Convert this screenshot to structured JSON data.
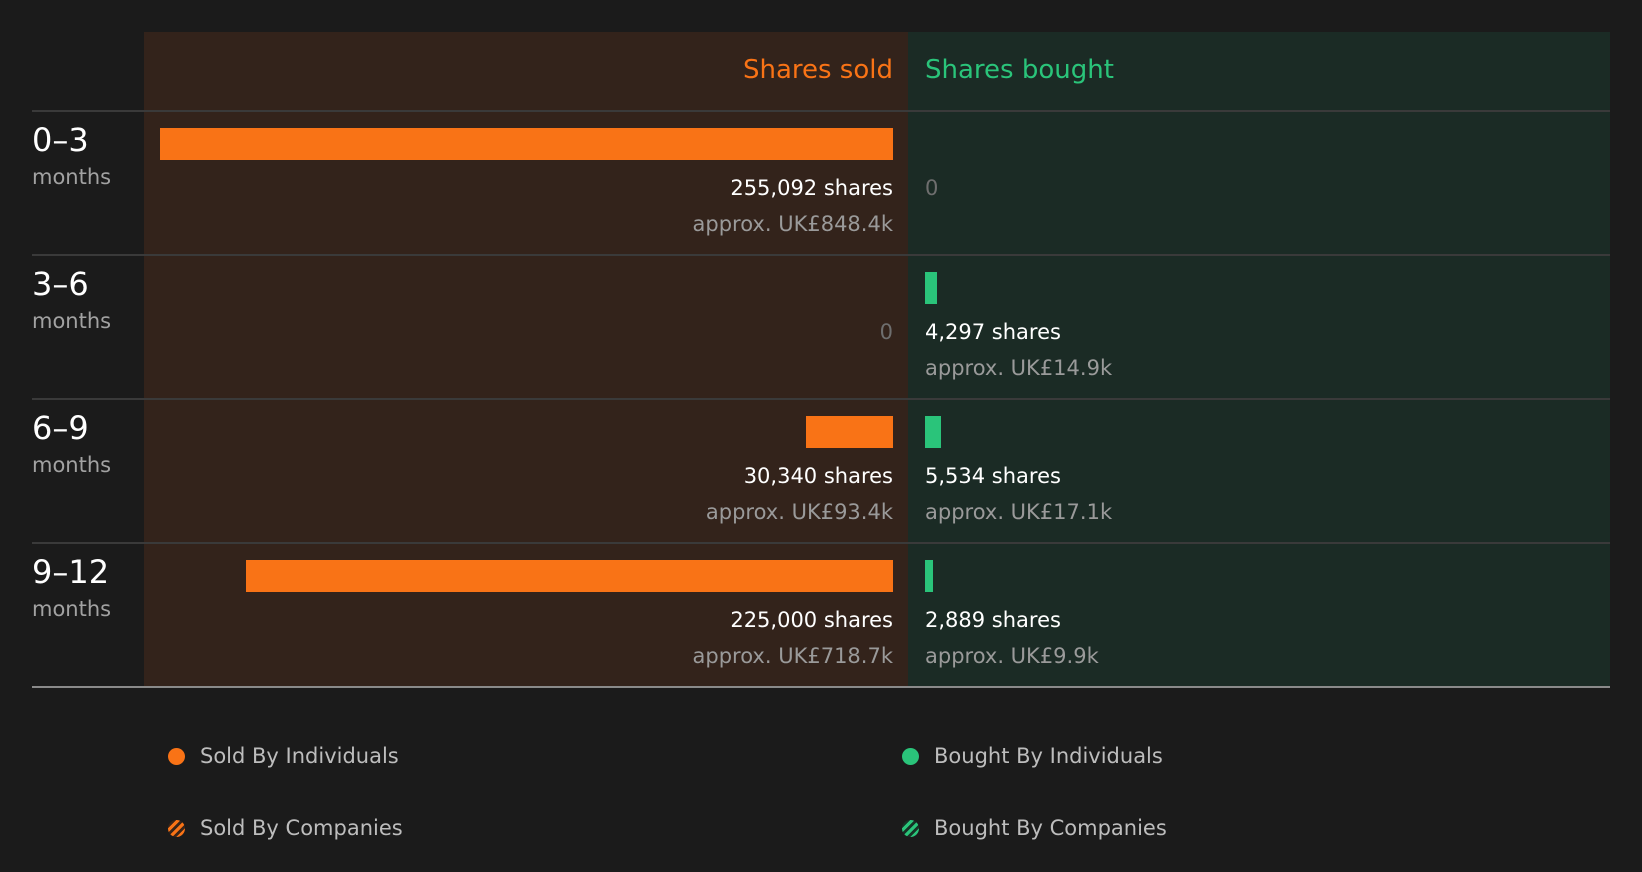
{
  "chart_data": {
    "type": "bar",
    "headers": {
      "sold": "Shares sold",
      "bought": "Shares bought"
    },
    "categories": [
      {
        "range": "0–3",
        "unit": "months"
      },
      {
        "range": "3–6",
        "unit": "months"
      },
      {
        "range": "6–9",
        "unit": "months"
      },
      {
        "range": "9–12",
        "unit": "months"
      }
    ],
    "series": [
      {
        "name": "Shares sold",
        "values": [
          255092,
          0,
          30340,
          225000
        ],
        "labels": [
          "255,092 shares",
          "0",
          "30,340 shares",
          "225,000 shares"
        ],
        "approx": [
          "approx. UK£848.4k",
          "",
          "approx. UK£93.4k",
          "approx. UK£718.7k"
        ]
      },
      {
        "name": "Shares bought",
        "values": [
          0,
          4297,
          5534,
          2889
        ],
        "labels": [
          "0",
          "4,297 shares",
          "5,534 shares",
          "2,889 shares"
        ],
        "approx": [
          "",
          "approx. UK£14.9k",
          "approx. UK£17.1k",
          "approx. UK£9.9k"
        ]
      }
    ],
    "legend": [
      {
        "label": "Sold By Individuals",
        "marker": "solid",
        "color": "#f97316"
      },
      {
        "label": "Bought By Individuals",
        "marker": "solid",
        "color": "#2ac47a"
      },
      {
        "label": "Sold By Companies",
        "marker": "hatched",
        "color": "#f97316"
      },
      {
        "label": "Bought By Companies",
        "marker": "hatched",
        "color": "#2ac47a"
      }
    ],
    "legend_placement": "bottom",
    "colors": {
      "sold": "#f97316",
      "bought": "#2ac47a"
    }
  }
}
